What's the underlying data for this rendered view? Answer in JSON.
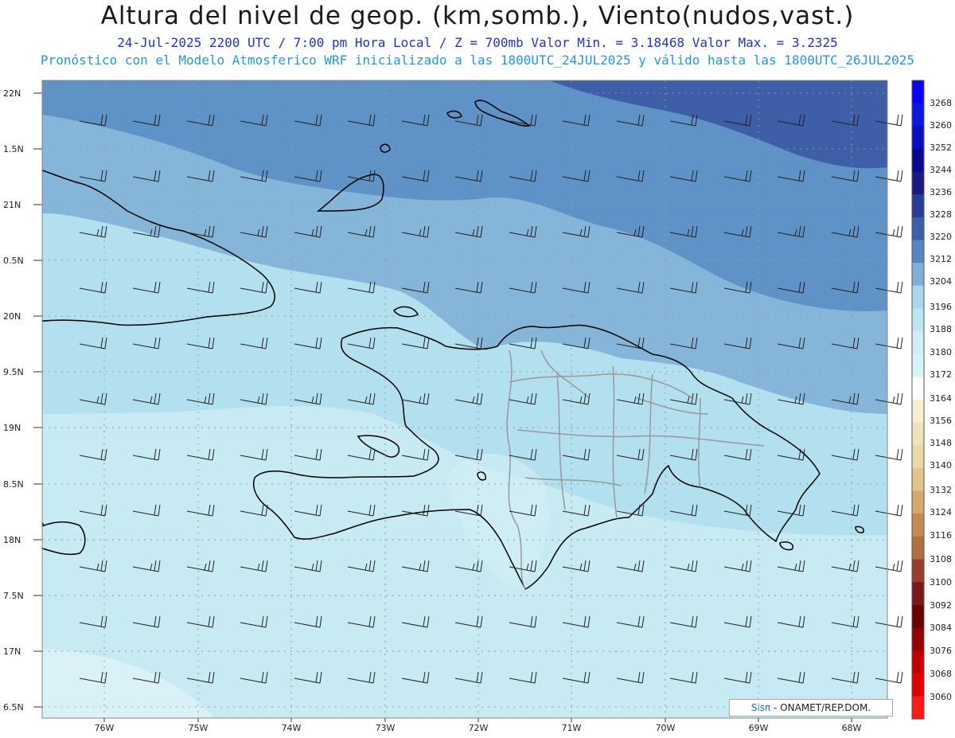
{
  "header": {
    "title": "Altura del nivel de geop. (km,somb.), Viento(nudos,vast.)",
    "subtitle1": "24-Jul-2025   2200 UTC / 7:00 pm Hora Local / Z = 700mb     Valor Min. = 3.18468  Valor Max. = 3.2325",
    "subtitle2": "Pronóstico con el Modelo Atmosferico WRF inicializado a las 1800UTC_24JUL2025 y válido hasta las  1800UTC_26JUL2025"
  },
  "axes": {
    "lat_labels": [
      "22N",
      "1.5N",
      "21N",
      "0.5N",
      "20N",
      "9.5N",
      "19N",
      "8.5N",
      "18N",
      "7.5N",
      "17N",
      "6.5N"
    ],
    "lon_labels": [
      "76W",
      "75W",
      "74W",
      "73W",
      "72W",
      "71W",
      "70W",
      "69W",
      "68W"
    ]
  },
  "colorbar": {
    "labels": [
      "3268",
      "3260",
      "3252",
      "3244",
      "3236",
      "3228",
      "3220",
      "3212",
      "3204",
      "3196",
      "3188",
      "3180",
      "3172",
      "3164",
      "3156",
      "3148",
      "3140",
      "3132",
      "3124",
      "3116",
      "3108",
      "3100",
      "3092",
      "3084",
      "3076",
      "3068",
      "3060"
    ],
    "colors": [
      "#0a00ff",
      "#0a1ae0",
      "#0a10c0",
      "#0a0890",
      "#1a1a80",
      "#2a3d95",
      "#3d5fa8",
      "#5886c0",
      "#80afd5",
      "#a8d6ea",
      "#bde6f0",
      "#cfeef5",
      "#d8f4f8",
      "#ffffff",
      "#f7efd0",
      "#f0e2bb",
      "#ecd7a8",
      "#e3c38c",
      "#d5a870",
      "#c38a55",
      "#b0703f",
      "#963f2b",
      "#7a1818",
      "#6a0000",
      "#950000",
      "#c00000",
      "#e00000",
      "#ff1a1a"
    ]
  },
  "credit": {
    "sis": "Sisπ",
    "rest": " - ONAMET/REP.DOM."
  }
}
